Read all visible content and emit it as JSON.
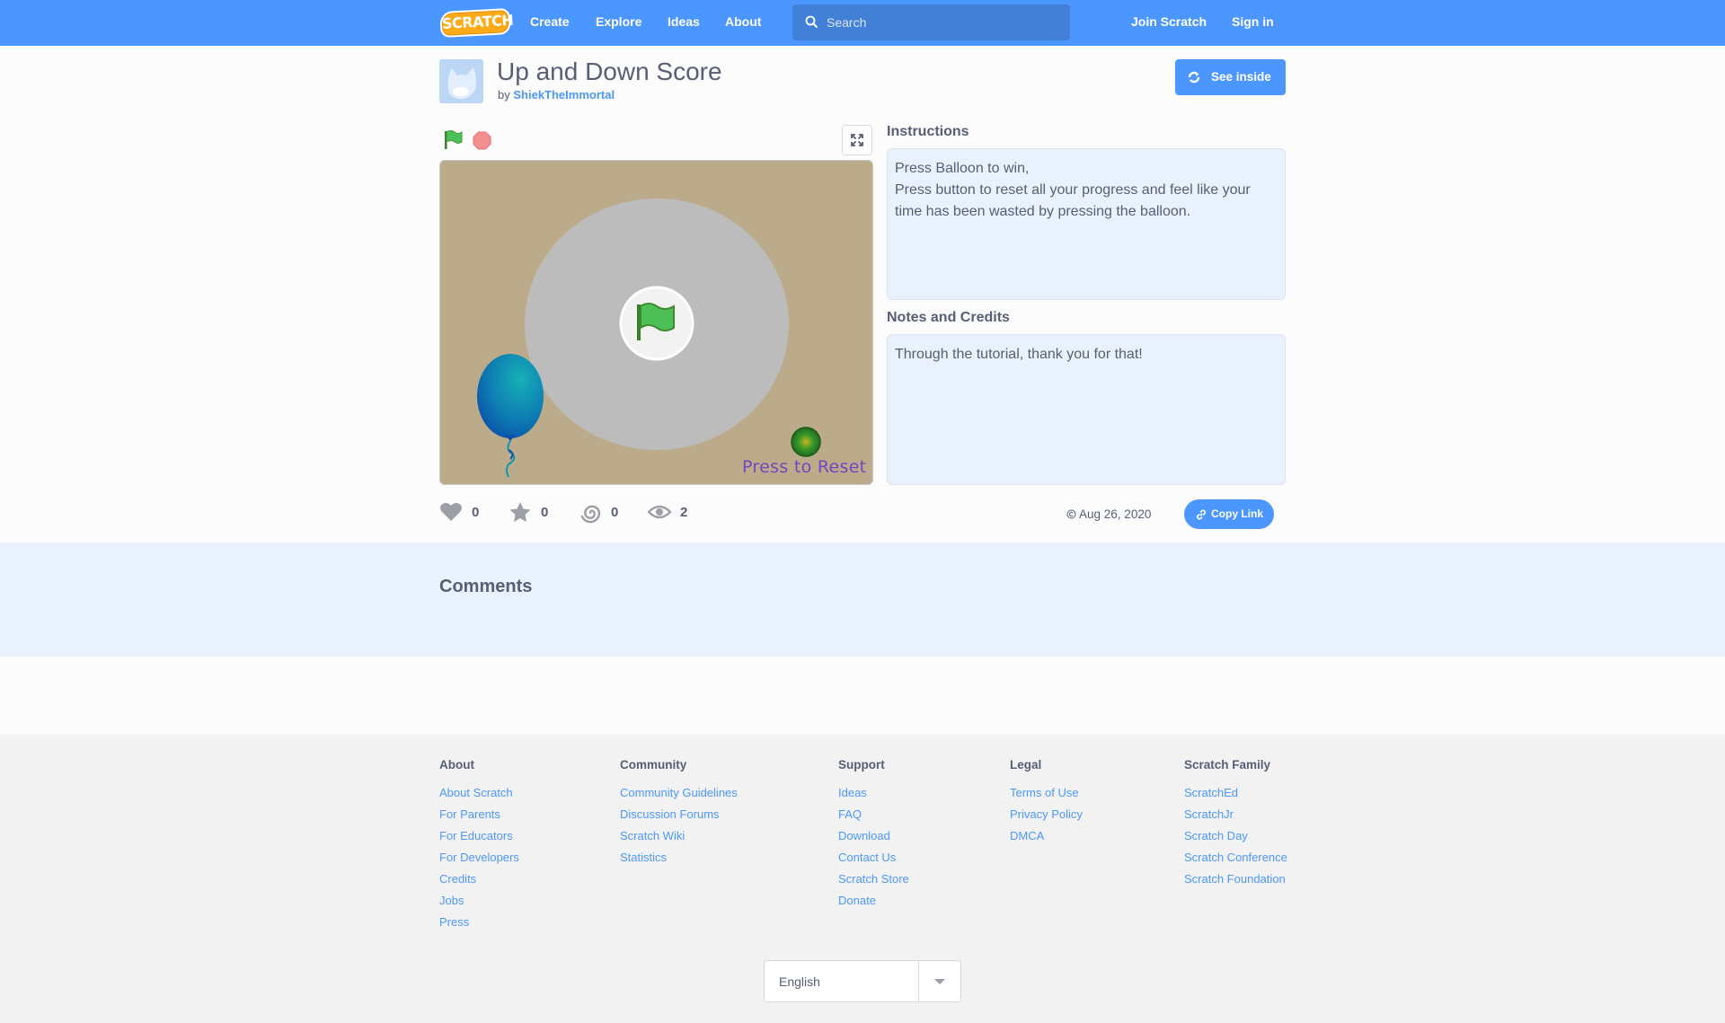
{
  "nav": {
    "logo_text": "SCRATCH",
    "create": "Create",
    "explore": "Explore",
    "ideas": "Ideas",
    "about": "About",
    "search_placeholder": "Search",
    "join": "Join Scratch",
    "sign_in": "Sign in"
  },
  "project": {
    "title": "Up and Down Score",
    "by_prefix": "by",
    "author": "ShiekTheImmortal",
    "see_inside": "See inside"
  },
  "stage": {
    "reset_text": "Press to Reset",
    "background_color": "#bcab8a"
  },
  "stats": {
    "loves": "0",
    "favorites": "0",
    "remixes": "0",
    "views": "2",
    "date": "Aug 26, 2020",
    "copy_link": "Copy Link"
  },
  "instructions": {
    "heading": "Instructions",
    "lines": [
      "Press Balloon to win,",
      "Press button to reset all your progress and feel like your",
      "time has been wasted by pressing the balloon."
    ]
  },
  "notes": {
    "heading": "Notes and Credits",
    "text": "Through the tutorial, thank you for that!"
  },
  "comments": {
    "heading": "Comments"
  },
  "footer": {
    "columns": [
      {
        "heading": "About",
        "links": [
          "About Scratch",
          "For Parents",
          "For Educators",
          "For Developers",
          "Credits",
          "Jobs",
          "Press"
        ]
      },
      {
        "heading": "Community",
        "links": [
          "Community Guidelines",
          "Discussion Forums",
          "Scratch Wiki",
          "Statistics"
        ]
      },
      {
        "heading": "Support",
        "links": [
          "Ideas",
          "FAQ",
          "Download",
          "Contact Us",
          "Scratch Store",
          "Donate"
        ]
      },
      {
        "heading": "Legal",
        "links": [
          "Terms of Use",
          "Privacy Policy",
          "DMCA"
        ]
      },
      {
        "heading": "Scratch Family",
        "links": [
          "ScratchEd",
          "ScratchJr",
          "Scratch Day",
          "Scratch Conference",
          "Scratch Foundation"
        ]
      }
    ],
    "language": "English"
  },
  "colors": {
    "brand": "#4c97ff",
    "text": "#575e75",
    "info_bg": "#e9f1fc"
  }
}
